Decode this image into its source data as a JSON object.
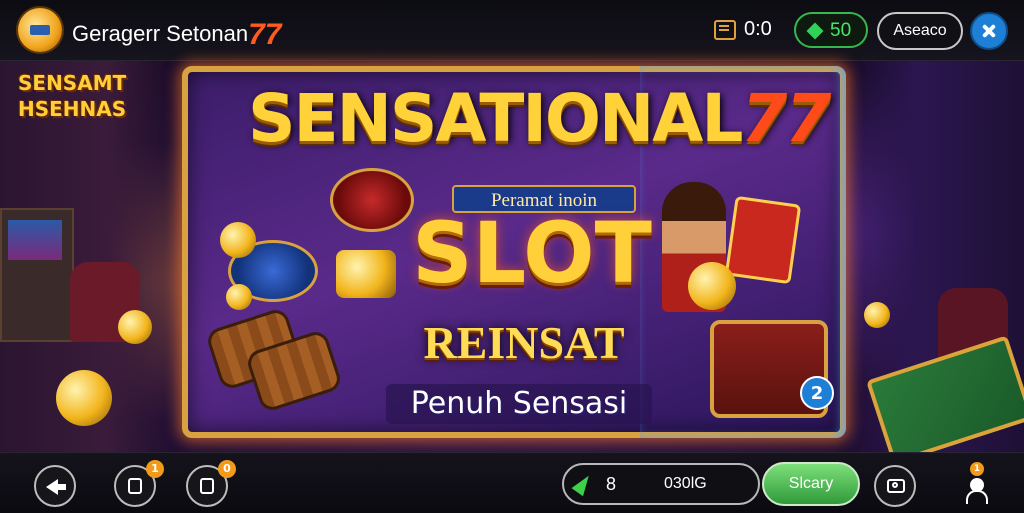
{
  "topbar": {
    "app_title": "Geragerr Setonan",
    "app_title_num": "77",
    "logo_icon": "coin-logo-icon",
    "timer_icon": "timer-icon",
    "timer_value": "0:0",
    "coins_icon": "gem-icon",
    "coins_value": "50",
    "account_label": "Aseaco",
    "close_icon": "close-icon"
  },
  "background": {
    "banner_left": "SENSAMT HSEHNAS"
  },
  "board": {
    "title": "SENSATIONAL",
    "title_num": "77",
    "subtitle": "Peramat inoin",
    "slot": "SLOT",
    "headline": "REINSAT",
    "tagline": "Penuh Sensasi",
    "info_badge": "2"
  },
  "bottombar": {
    "back_icon": "back-arrow-icon",
    "left_button_2_icon": "wallet-icon",
    "left_button_2_badge": "1",
    "left_button_3_icon": "shirt-icon",
    "left_button_3_badge": "0",
    "bet_icon": "bolt-icon",
    "bet_value": "8",
    "bet_total": "030lG",
    "start_label": "Slcary",
    "camera_icon": "camera-icon",
    "profile_icon": "person-icon",
    "profile_badge": "1"
  },
  "colors": {
    "accent_gold": "#ffd23a",
    "title_red": "#ff4a1a",
    "coin_green": "#4be36a",
    "close_blue": "#1e7fd6",
    "start_green": "#2f9a3a"
  }
}
